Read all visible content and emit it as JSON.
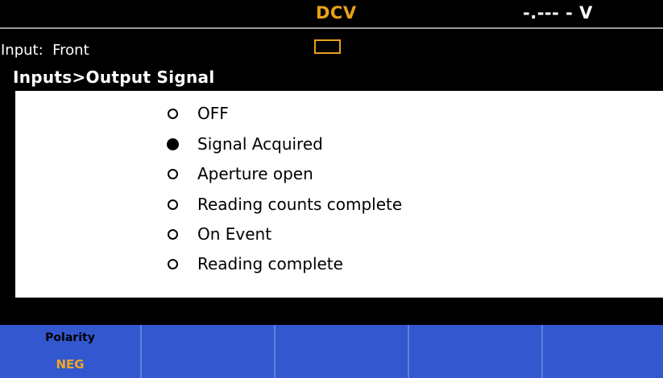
{
  "header": {
    "mode": "DCV",
    "reading": "-.--- - V"
  },
  "status": {
    "input_label": "Input:  Front",
    "indicator_color": "#e8a21a"
  },
  "breadcrumb": "Inputs>Output Signal",
  "options": [
    {
      "label": "OFF",
      "selected": false
    },
    {
      "label": "Signal Acquired",
      "selected": true
    },
    {
      "label": "Aperture open",
      "selected": false
    },
    {
      "label": "Reading counts complete",
      "selected": false
    },
    {
      "label": "On Event",
      "selected": false
    },
    {
      "label": "Reading complete",
      "selected": false
    }
  ],
  "softkeys": [
    {
      "title": "Polarity",
      "value": "NEG"
    },
    {
      "title": "",
      "value": ""
    },
    {
      "title": "",
      "value": ""
    },
    {
      "title": "",
      "value": ""
    },
    {
      "title": "",
      "value": ""
    }
  ],
  "colors": {
    "softkey_bg": "#3257cf",
    "accent": "#e8a21a"
  }
}
